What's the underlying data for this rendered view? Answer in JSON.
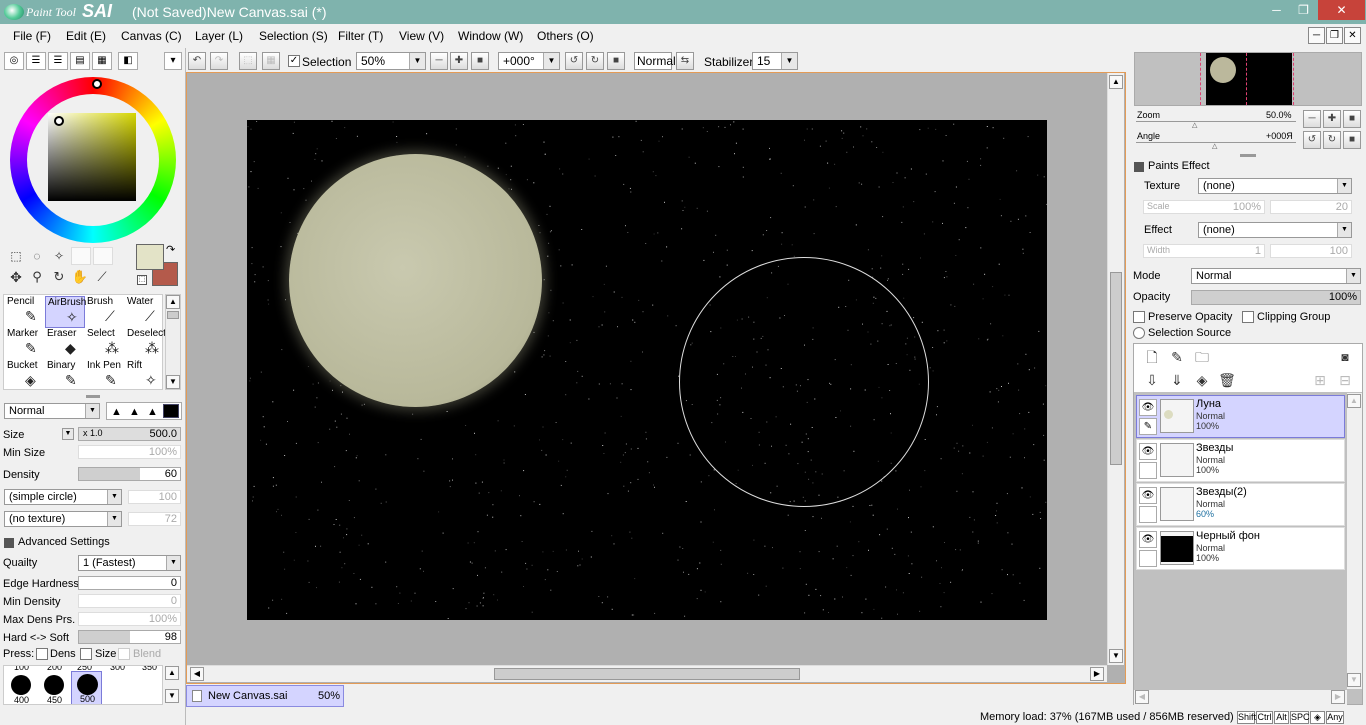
{
  "window": {
    "app_name_small": "Paint Tool",
    "app_name_big": "SAI",
    "title": "(Not Saved)New Canvas.sai (*)",
    "min_glyph": "─",
    "restore_glyph": "❐",
    "close_glyph": "✕"
  },
  "menu": [
    "File (F)",
    "Edit (E)",
    "Canvas (C)",
    "Layer (L)",
    "Selection (S)",
    "Filter (T)",
    "View (V)",
    "Window (W)",
    "Others (O)"
  ],
  "toolbar": {
    "selection_label": "Selection",
    "zoom": "50%",
    "angle": "+000°",
    "blend": "Normal",
    "stabilizer_label": "Stabilizer",
    "stabilizer_value": "15"
  },
  "colors": {
    "primary": "#e3e3c7",
    "secondary": "#b45a4b",
    "accent": "#d4d4ff",
    "titlebar": "#7fb3ad"
  },
  "tools": [
    {
      "label": "Pencil",
      "icon": "pencil-icon",
      "glyph": "✎"
    },
    {
      "label": "AirBrush",
      "icon": "airbrush-icon",
      "glyph": "✧"
    },
    {
      "label": "Brush",
      "icon": "brush-icon",
      "glyph": "⟋"
    },
    {
      "label": "Water",
      "icon": "water-icon",
      "glyph": "⟋"
    },
    {
      "label": "Marker",
      "icon": "marker-icon",
      "glyph": "✎"
    },
    {
      "label": "Eraser",
      "icon": "eraser-icon",
      "glyph": "◆"
    },
    {
      "label": "Select",
      "icon": "select-icon",
      "glyph": "⁂"
    },
    {
      "label": "Deselect",
      "icon": "deselect-icon",
      "glyph": "⁂"
    },
    {
      "label": "Bucket",
      "icon": "bucket-icon",
      "glyph": "◈"
    },
    {
      "label": "Binary",
      "icon": "binary-icon",
      "glyph": "✎"
    },
    {
      "label": "Ink Pen",
      "icon": "ink-pen-icon",
      "glyph": "✎"
    },
    {
      "label": "Rift",
      "icon": "rift-icon",
      "glyph": "✧"
    }
  ],
  "brush": {
    "mode": "Normal",
    "size_label": "Size",
    "size_mult": "x 1.0",
    "size": "500.0",
    "min_size_label": "Min Size",
    "min_size": "100%",
    "density_label": "Density",
    "density": "60",
    "density_fill": 0.6,
    "shape": "(simple circle)",
    "shape_value": "100",
    "texture": "(no texture)",
    "texture_value": "72",
    "advanced_label": "Advanced Settings",
    "quality_label": "Quailty",
    "quality": "1 (Fastest)",
    "edge_label": "Edge Hardness",
    "edge": "0",
    "min_density_label": "Min Density",
    "min_density": "0",
    "max_dens_label": "Max Dens Prs.",
    "max_dens": "100%",
    "hardsoft_label": "Hard <-> Soft",
    "hardsoft": "98",
    "hardsoft_fill": 0.5,
    "press_label": "Press:",
    "press_dens": "Dens",
    "press_size": "Size",
    "press_blend": "Blend"
  },
  "brush_sizes": {
    "top": [
      "100",
      "200",
      "250",
      "300",
      "350"
    ],
    "bottom": [
      "400",
      "450",
      "500"
    ]
  },
  "document_tab": {
    "name": "New Canvas.sai",
    "zoom": "50%"
  },
  "status": {
    "memory": "Memory load: 37% (167MB used / 856MB reserved)",
    "keys": [
      "Shift",
      "Ctrl",
      "Alt",
      "SPC",
      "◈",
      "Any"
    ]
  },
  "navigator": {
    "zoom_label": "Zoom",
    "zoom_value": "50.0%",
    "angle_label": "Angle",
    "angle_value": "+000Я"
  },
  "paints_effect": {
    "header": "Paints Effect",
    "texture_label": "Texture",
    "texture": "(none)",
    "scale_label": "Scale",
    "scale_value": "100%",
    "scale_value2": "20",
    "effect_label": "Effect",
    "effect": "(none)",
    "width_label": "Width",
    "width_value": "1",
    "width_value2": "100"
  },
  "layer_props": {
    "mode_label": "Mode",
    "mode": "Normal",
    "opacity_label": "Opacity",
    "opacity": "100%",
    "preserve_label": "Preserve Opacity",
    "clipping_label": "Clipping Group",
    "selection_source_label": "Selection Source"
  },
  "layers": [
    {
      "name": "Луна",
      "mode": "Normal",
      "opacity": "100%",
      "selected": true
    },
    {
      "name": "Звезды",
      "mode": "Normal",
      "opacity": "100%",
      "selected": false
    },
    {
      "name": "Звезды(2)",
      "mode": "Normal",
      "opacity": "60%",
      "selected": false
    },
    {
      "name": "Черный фон",
      "mode": "Normal",
      "opacity": "100%",
      "selected": false
    }
  ]
}
